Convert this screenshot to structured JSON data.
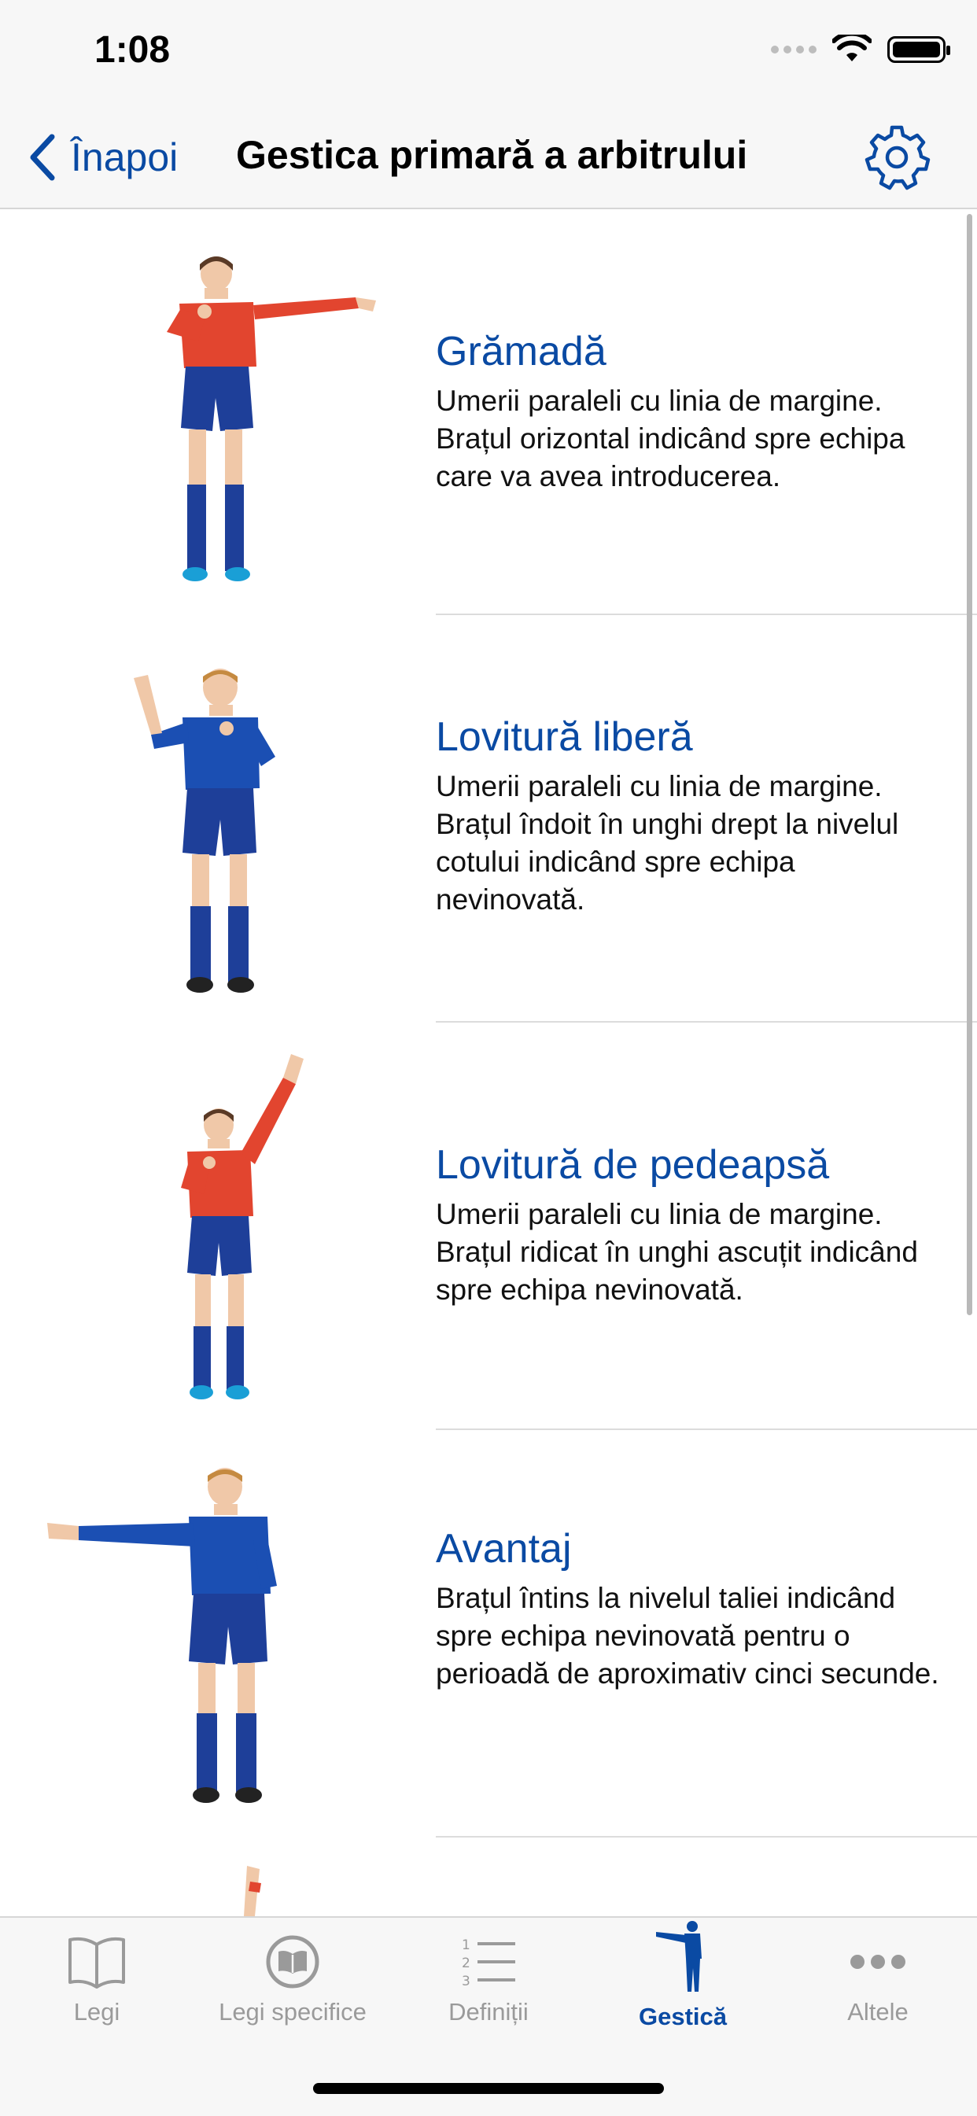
{
  "status": {
    "time": "1:08"
  },
  "nav": {
    "back_label": "Înapoi",
    "title": "Gestica primară a arbitrului"
  },
  "items": [
    {
      "title": "Grămadă",
      "description": "Umerii paraleli cu linia de margine. Brațul orizontal indicând spre echipa care va avea introducerea."
    },
    {
      "title": "Lovitură liberă",
      "description": "Umerii paraleli cu linia de margine. Brațul îndoit în unghi drept la nivelul cotului indicând spre echipa nevinovată."
    },
    {
      "title": "Lovitură de pedeapsă",
      "description": "Umerii paraleli cu linia de margine. Brațul ridicat în unghi ascuțit indicând spre echipa nevinovată."
    },
    {
      "title": "Avantaj",
      "description": "Brațul întins la nivelul taliei indicând spre echipa nevinovată pentru o perioadă de aproximativ cinci secunde."
    }
  ],
  "tabs": [
    {
      "label": "Legi",
      "icon": "book-icon",
      "active": false
    },
    {
      "label": "Legi specifice",
      "icon": "book-circle-icon",
      "active": false
    },
    {
      "label": "Definiții",
      "icon": "numbered-list-icon",
      "active": false
    },
    {
      "label": "Gestică",
      "icon": "referee-gesture-icon",
      "active": true
    },
    {
      "label": "Altele",
      "icon": "more-icon",
      "active": false
    }
  ],
  "colors": {
    "accent": "#0a4aa3",
    "shirt_red": "#e2452f",
    "shirt_blue": "#1b4fb3",
    "shorts": "#1e3f99",
    "tab_inactive": "#9a9a9a"
  }
}
